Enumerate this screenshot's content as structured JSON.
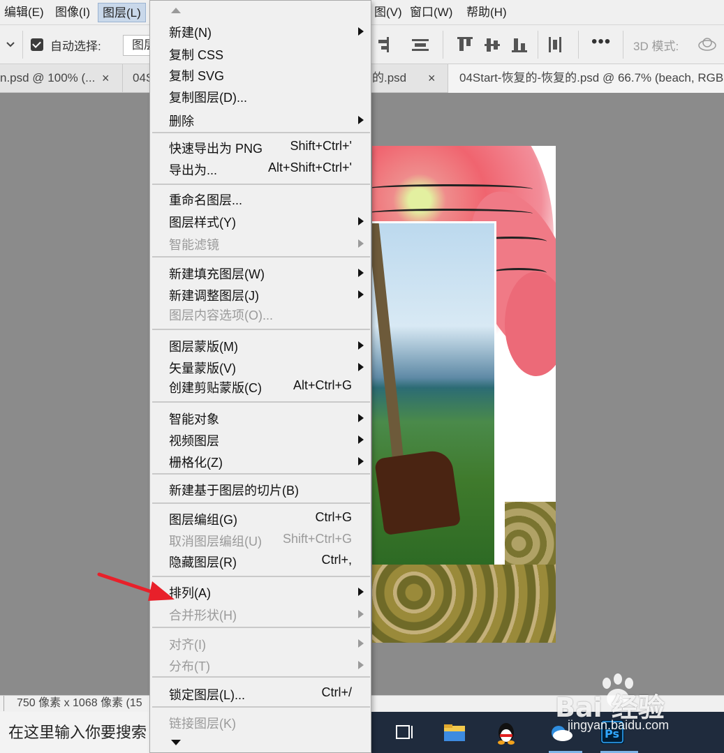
{
  "menubar": {
    "items": [
      "编辑(E)",
      "图像(I)",
      "图层(L)",
      "图(V)",
      "窗口(W)",
      "帮助(H)"
    ],
    "active": "图层(L)"
  },
  "options": {
    "auto_select_label": "自动选择:",
    "auto_select_checked": true,
    "target_value": "图层",
    "mode_3d_label": "3D 模式:"
  },
  "tabs": [
    {
      "label": "n.psd @ 100% (...",
      "close": "×"
    },
    {
      "label": "04S",
      "close": ""
    },
    {
      "label": "的.psd",
      "close": "×"
    },
    {
      "label": "04Start-恢复的-恢复的.psd @ 66.7% (beach, RGB",
      "close": ""
    }
  ],
  "statusbar": {
    "doc_size": "750 像素 x 1068 像素 (15"
  },
  "taskbar": {
    "search_placeholder": "在这里输入你要搜索"
  },
  "layer_menu": {
    "groups": [
      [
        {
          "label": "新建(N)",
          "submenu": true,
          "enabled": true
        },
        {
          "label": "复制 CSS",
          "enabled": true
        },
        {
          "label": "复制 SVG",
          "enabled": true
        },
        {
          "label": "复制图层(D)...",
          "enabled": true
        },
        {
          "label": "删除",
          "submenu": true,
          "enabled": true
        }
      ],
      [
        {
          "label": "快速导出为 PNG",
          "shortcut": "Shift+Ctrl+'",
          "enabled": true
        },
        {
          "label": "导出为...",
          "shortcut": "Alt+Shift+Ctrl+'",
          "enabled": true
        }
      ],
      [
        {
          "label": "重命名图层...",
          "enabled": true
        },
        {
          "label": "图层样式(Y)",
          "submenu": true,
          "enabled": true
        },
        {
          "label": "智能滤镜",
          "submenu": true,
          "enabled": false
        }
      ],
      [
        {
          "label": "新建填充图层(W)",
          "submenu": true,
          "enabled": true
        },
        {
          "label": "新建调整图层(J)",
          "submenu": true,
          "enabled": true
        },
        {
          "label": "图层内容选项(O)...",
          "enabled": false
        }
      ],
      [
        {
          "label": "图层蒙版(M)",
          "submenu": true,
          "enabled": true
        },
        {
          "label": "矢量蒙版(V)",
          "submenu": true,
          "enabled": true
        },
        {
          "label": "创建剪贴蒙版(C)",
          "shortcut": "Alt+Ctrl+G",
          "enabled": true
        }
      ],
      [
        {
          "label": "智能对象",
          "submenu": true,
          "enabled": true
        },
        {
          "label": "视频图层",
          "submenu": true,
          "enabled": true
        },
        {
          "label": "栅格化(Z)",
          "submenu": true,
          "enabled": true
        }
      ],
      [
        {
          "label": "新建基于图层的切片(B)",
          "enabled": true
        }
      ],
      [
        {
          "label": "图层编组(G)",
          "shortcut": "Ctrl+G",
          "enabled": true
        },
        {
          "label": "取消图层编组(U)",
          "shortcut": "Shift+Ctrl+G",
          "enabled": false
        },
        {
          "label": "隐藏图层(R)",
          "shortcut": "Ctrl+,",
          "enabled": true
        }
      ],
      [
        {
          "label": "排列(A)",
          "submenu": true,
          "enabled": true
        },
        {
          "label": "合并形状(H)",
          "submenu": true,
          "enabled": false
        }
      ],
      [
        {
          "label": "对齐(I)",
          "submenu": true,
          "enabled": false
        },
        {
          "label": "分布(T)",
          "submenu": true,
          "enabled": false
        }
      ],
      [
        {
          "label": "锁定图层(L)...",
          "shortcut": "Ctrl+/",
          "enabled": true
        }
      ],
      [
        {
          "label": "链接图层(K)",
          "enabled": false
        }
      ]
    ]
  },
  "watermark": {
    "brand": "Bai 经验",
    "url": "jingyan.baidu.com"
  },
  "colors": {
    "annotation_arrow": "#e8202a",
    "canvas_bg": "#8b8b8b",
    "menu_bg": "#f0f0f0",
    "disabled_text": "#9a9a9a"
  }
}
